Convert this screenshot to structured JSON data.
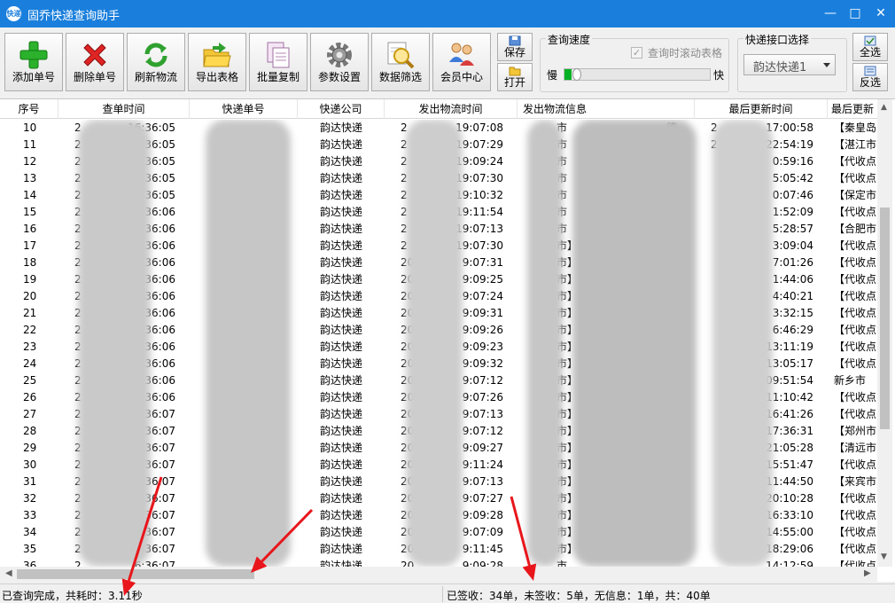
{
  "window": {
    "title": "固乔快递查询助手",
    "icon_text": "快递",
    "controls": [
      "—",
      "□",
      "✕"
    ]
  },
  "toolbar": {
    "buttons": [
      {
        "label": "添加单号",
        "icon": "plus-icon"
      },
      {
        "label": "删除单号",
        "icon": "delete-x-icon"
      },
      {
        "label": "刷新物流",
        "icon": "refresh-icon"
      },
      {
        "label": "导出表格",
        "icon": "folder-export-icon"
      },
      {
        "label": "批量复制",
        "icon": "copy-pages-icon"
      },
      {
        "label": "参数设置",
        "icon": "gear-icon"
      },
      {
        "label": "数据筛选",
        "icon": "magnifier-filter-icon"
      },
      {
        "label": "会员中心",
        "icon": "users-icon"
      }
    ],
    "save_label": "保存",
    "open_label": "打开",
    "speed_group_title": "查询速度",
    "scroll_checkbox_label": "查询时滚动表格",
    "scroll_checkbox_checked": true,
    "slow_label": "慢",
    "fast_label": "快",
    "speed_level": 0.05,
    "api_group_title": "快递接口选择",
    "api_selected": "韵达快递1",
    "select_all_label": "全选",
    "invert_label": "反选"
  },
  "grid": {
    "columns": [
      "序号",
      "查单时间",
      "快递单号",
      "快递公司",
      "发出物流时间",
      "发出物流信息",
      "最后更新时间",
      "最后更新"
    ],
    "rows": [
      {
        "no": "10",
        "query_prefix": "2",
        "query_time": "16:36:05",
        "company": "韵达快递",
        "send_prefix": "2",
        "send_time": "19:07:08",
        "info": "市",
        "info_tail": "德…",
        "upd_prefix": "2",
        "upd_time": "17:00:58",
        "latest": "【秦皇岛"
      },
      {
        "no": "11",
        "query_prefix": "2",
        "query_time": "16:36:05",
        "company": "韵达快递",
        "send_prefix": "2",
        "send_time": "19:07:29",
        "info": "市",
        "info_tail": "…",
        "upd_prefix": "2",
        "upd_time": "22:54:19",
        "latest": "【湛江市"
      },
      {
        "no": "12",
        "query_prefix": "2",
        "query_time": "6:36:05",
        "company": "韵达快递",
        "send_prefix": "2",
        "send_time": "19:09:24",
        "info": "市",
        "info_tail": "…",
        "upd_prefix": "",
        "upd_time": "0:59:16",
        "latest": "【代收点"
      },
      {
        "no": "13",
        "query_prefix": "2",
        "query_time": "6:36:05",
        "company": "韵达快递",
        "send_prefix": "2",
        "send_time": "19:07:30",
        "info": "市",
        "info_tail": "…",
        "upd_prefix": "",
        "upd_time": "5:05:42",
        "latest": "【代收点"
      },
      {
        "no": "14",
        "query_prefix": "2",
        "query_time": "6:36:05",
        "company": "韵达快递",
        "send_prefix": "2",
        "send_time": "19:10:32",
        "info": "市",
        "info_tail": "…",
        "upd_prefix": "",
        "upd_time": "0:07:46",
        "latest": "【保定市"
      },
      {
        "no": "15",
        "query_prefix": "2",
        "query_time": "6:36:06",
        "company": "韵达快递",
        "send_prefix": "2",
        "send_time": "19:11:54",
        "info": "市",
        "info_tail": "…",
        "upd_prefix": "",
        "upd_time": "1:52:09",
        "latest": "【代收点"
      },
      {
        "no": "16",
        "query_prefix": "2",
        "query_time": "6:36:06",
        "company": "韵达快递",
        "send_prefix": "2",
        "send_time": "19:07:13",
        "info": "市",
        "info_tail": "…",
        "upd_prefix": "",
        "upd_time": "5:28:57",
        "latest": "【合肥市"
      },
      {
        "no": "17",
        "query_prefix": "2",
        "query_time": "6:36:06",
        "company": "韵达快递",
        "send_prefix": "2",
        "send_time": "19:07:30",
        "info": "市】",
        "info_tail": "…",
        "upd_prefix": "",
        "upd_time": "3:09:04",
        "latest": "【代收点"
      },
      {
        "no": "18",
        "query_prefix": "2",
        "query_time": "6:36:06",
        "company": "韵达快递",
        "send_prefix": "20",
        "send_time": "9:07:31",
        "info": "市】",
        "info_tail": "…",
        "upd_prefix": "",
        "upd_time": "7:01:26",
        "latest": "【代收点"
      },
      {
        "no": "19",
        "query_prefix": "2",
        "query_time": "6:36:06",
        "company": "韵达快递",
        "send_prefix": "20",
        "send_time": "9:09:25",
        "info": "市】",
        "info_tail": "…",
        "upd_prefix": "",
        "upd_time": "1:44:06",
        "latest": "【代收点"
      },
      {
        "no": "20",
        "query_prefix": "2",
        "query_time": "16:36:06",
        "company": "韵达快递",
        "send_prefix": "20",
        "send_time": "9:07:24",
        "info": "市】",
        "info_tail": "…",
        "upd_prefix": "",
        "upd_time": "4:40:21",
        "latest": "【代收点"
      },
      {
        "no": "21",
        "query_prefix": "2",
        "query_time": "16:36:06",
        "company": "韵达快递",
        "send_prefix": "20",
        "send_time": "9:09:31",
        "info": "市】",
        "info_tail": "…",
        "upd_prefix": "",
        "upd_time": "3:32:15",
        "latest": "【代收点"
      },
      {
        "no": "22",
        "query_prefix": "2",
        "query_time": "16:36:06",
        "company": "韵达快递",
        "send_prefix": "20",
        "send_time": "9:09:26",
        "info": "市】",
        "info_tail": "…",
        "upd_prefix": "",
        "upd_time": "6:46:29",
        "latest": "【代收点"
      },
      {
        "no": "23",
        "query_prefix": "2",
        "query_time": "16:36:06",
        "company": "韵达快递",
        "send_prefix": "20",
        "send_time": "9:09:23",
        "info": "市】",
        "info_tail": "…",
        "upd_prefix": "",
        "upd_time": "13:11:19",
        "latest": "【代收点"
      },
      {
        "no": "24",
        "query_prefix": "2",
        "query_time": "6:36:06",
        "company": "韵达快递",
        "send_prefix": "20",
        "send_time": "9:09:32",
        "info": "市】",
        "info_tail": "…",
        "upd_prefix": "",
        "upd_time": "13:05:17",
        "latest": "【代收点"
      },
      {
        "no": "25",
        "query_prefix": "2",
        "query_time": "6:36:06",
        "company": "韵达快递",
        "send_prefix": "20",
        "send_time": "9:07:12",
        "info": "市】",
        "info_tail": "…",
        "upd_prefix": "",
        "upd_time": "09:51:54",
        "latest": "新乡市"
      },
      {
        "no": "26",
        "query_prefix": "2",
        "query_time": "6:36:06",
        "company": "韵达快递",
        "send_prefix": "20",
        "send_time": "9:07:26",
        "info": "市】",
        "info_tail": "…",
        "upd_prefix": "",
        "upd_time": "11:10:42",
        "latest": "【代收点"
      },
      {
        "no": "27",
        "query_prefix": "2",
        "query_time": "36:07",
        "company": "韵达快递",
        "send_prefix": "20",
        "send_time": "9:07:13",
        "info": "市】",
        "info_tail": "…",
        "upd_prefix": "",
        "upd_time": "16:41:26",
        "latest": "【代收点"
      },
      {
        "no": "28",
        "query_prefix": "2",
        "query_time": "36:07",
        "company": "韵达快递",
        "send_prefix": "20",
        "send_time": "9:07:12",
        "info": "市】",
        "info_tail": "…",
        "upd_prefix": "",
        "upd_time": "17:36:31",
        "latest": "【郑州市"
      },
      {
        "no": "29",
        "query_prefix": "2",
        "query_time": "36:07",
        "company": "韵达快递",
        "send_prefix": "20",
        "send_time": "9:09:27",
        "info": "市】",
        "info_tail": "…",
        "upd_prefix": "",
        "upd_time": "21:05:28",
        "latest": "【清远市"
      },
      {
        "no": "30",
        "query_prefix": "2",
        "query_time": "36:07",
        "company": "韵达快递",
        "send_prefix": "20",
        "send_time": "9:11:24",
        "info": "市】",
        "info_tail": "…",
        "upd_prefix": "",
        "upd_time": "15:51:47",
        "latest": "【代收点"
      },
      {
        "no": "31",
        "query_prefix": "2",
        "query_time": "36:07",
        "company": "韵达快递",
        "send_prefix": "20",
        "send_time": "9:07:13",
        "info": "市】",
        "info_tail": "…",
        "upd_prefix": "",
        "upd_time": "11:44:50",
        "latest": "【来宾市"
      },
      {
        "no": "32",
        "query_prefix": "2",
        "query_time": "6:36:07",
        "company": "韵达快递",
        "send_prefix": "20",
        "send_time": "9:07:27",
        "info": "市】",
        "info_tail": "…",
        "upd_prefix": "",
        "upd_time": "20:10:28",
        "latest": "【代收点"
      },
      {
        "no": "33",
        "query_prefix": "2",
        "query_time": "6:36:07",
        "company": "韵达快递",
        "send_prefix": "20",
        "send_time": "9:09:28",
        "info": "市】",
        "info_tail": "…",
        "upd_prefix": "",
        "upd_time": "16:33:10",
        "latest": "【代收点"
      },
      {
        "no": "34",
        "query_prefix": "2",
        "query_time": "6:36:07",
        "company": "韵达快递",
        "send_prefix": "20",
        "send_time": "9:07:09",
        "info": "市】",
        "info_tail": "…",
        "upd_prefix": "",
        "upd_time": "14:55:00",
        "latest": "【代收点"
      },
      {
        "no": "35",
        "query_prefix": "2",
        "query_time": "6:36:07",
        "company": "韵达快递",
        "send_prefix": "20",
        "send_time": "9:11:45",
        "info": "市】",
        "info_tail": "…",
        "upd_prefix": "",
        "upd_time": "18:29:06",
        "latest": "【代收点"
      },
      {
        "no": "36",
        "query_prefix": "2",
        "query_time": "6:36:07",
        "company": "韵达快递",
        "send_prefix": "20",
        "send_time": "9:09:28",
        "info": "市",
        "info_tail": "…",
        "upd_prefix": "",
        "upd_time": "14:12:59",
        "latest": "【代收点"
      }
    ]
  },
  "status": {
    "left": "已查询完成，共耗时：3.11秒",
    "right": "已签收：34单，未签收：5单，无信息：1单，共：40单"
  },
  "annotation_color": "#e8161b",
  "colors": {
    "titlebar": "#1a7fdc",
    "slider_fill": "#06b025"
  }
}
